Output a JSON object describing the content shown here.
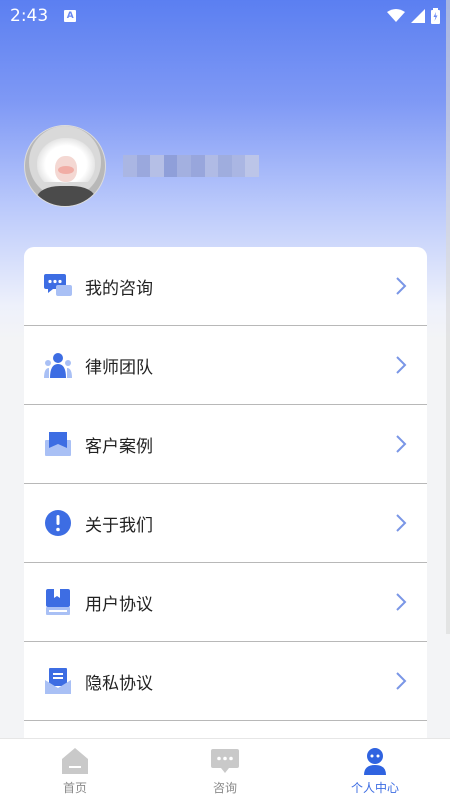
{
  "status_bar": {
    "time": "2:43",
    "notification_letter": "A"
  },
  "menu": {
    "items": [
      {
        "label": "我的咨询",
        "icon": "chat-bubbles-icon"
      },
      {
        "label": "律师团队",
        "icon": "team-icon"
      },
      {
        "label": "客户案例",
        "icon": "case-folder-icon"
      },
      {
        "label": "关于我们",
        "icon": "info-exclamation-icon"
      },
      {
        "label": "用户协议",
        "icon": "user-agreement-book-icon"
      },
      {
        "label": "隐私协议",
        "icon": "privacy-document-icon"
      }
    ]
  },
  "tabbar": {
    "tabs": [
      {
        "label": "首页",
        "icon": "home-icon",
        "active": false
      },
      {
        "label": "咨询",
        "icon": "consult-chat-icon",
        "active": false
      },
      {
        "label": "个人中心",
        "icon": "profile-icon",
        "active": true
      }
    ]
  },
  "colors": {
    "accent": "#3d6de3",
    "tab_inactive": "#8a8a8a",
    "gradient_top": "#5b7ff1"
  }
}
